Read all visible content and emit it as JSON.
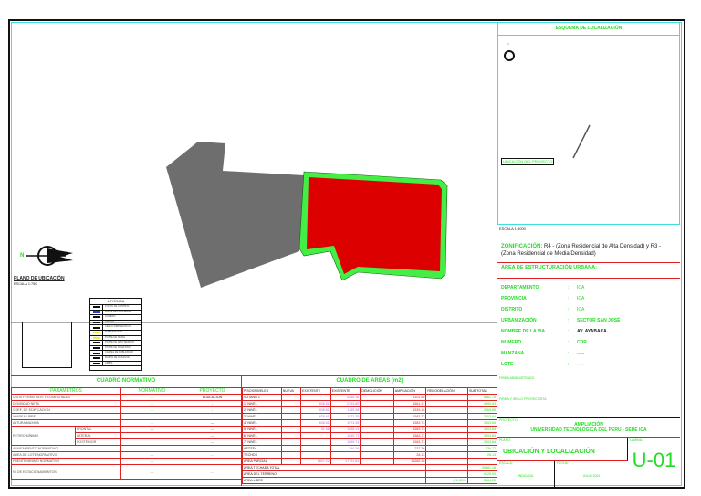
{
  "location_plan": {
    "title": "PLANO DE UBICACIÓN",
    "scale": "ESCALA 1:750",
    "north": "N"
  },
  "legend": {
    "title": "LEYENDA",
    "items": [
      "PUNTO DE CONTROL",
      "LIMITE DE PROPIEDAD",
      "LINDERO",
      "VEREDA",
      "CERCO PERIMETRICO",
      "SUB ESTACION",
      "POSTE DE MEDIA",
      "POSTE DE ALTA TENSION",
      "POSTE DE TELEFONO",
      "CARTEL DE PUBLICIDAD",
      "BUZON DE DESAGUE",
      "ARBOL"
    ]
  },
  "colors": {
    "project": "#dd0000",
    "neighbor": "#6e6e6e",
    "wall": "#44ee44",
    "border": "#3fe0e0",
    "lines": "#e02020",
    "text": "#22dd22"
  },
  "scheme": {
    "title": "ESQUEMA DE LOCALIZACIÓN",
    "north": "N",
    "pointer_label": "UBICACIÓN DEL PROYECTO",
    "scale": "ESCALA 1:5000"
  },
  "info": {
    "zoning_label": "ZONIFICACIÓN:",
    "zoning_value": "R4 - (Zona Residencial de Alta Densidad) y R3 - (Zona Residencial de Media Densidad)",
    "urban_area_label": "AREA DE ESTRUCTURACIÓN URBANA:",
    "urban_area_value": "-",
    "rows": [
      {
        "label": "DEPARTAMENTO",
        "value": "ICA"
      },
      {
        "label": "PROVINCIA",
        "value": "ICA"
      },
      {
        "label": "DISTRITO",
        "value": "ICA"
      },
      {
        "label": "URBANIZACIÓN",
        "value": "SECTOR SAN JOSÉ"
      },
      {
        "label": "NOMBRE DE LA VIA",
        "value": "AV. AYABACA"
      },
      {
        "label": "NUMERO",
        "value": "CDR"
      },
      {
        "label": "MANZANA",
        "value": "-----"
      },
      {
        "label": "LOTE",
        "value": "-----"
      }
    ]
  },
  "title_block": {
    "admin_sign": "FIRMA ADMINISTRADO",
    "designer_sign": "FIRMA Y SELLO PROYECTISTA",
    "project_label": "PROYECTO:",
    "project_line1": "AMPLIACIÓN",
    "project_line2": "UNIVERSIDAD TECNOLOGICA DEL PERU - SEDE ICA",
    "plan_label": "PLANO:",
    "plan_value": "UBICACIÓN Y LOCALIZACIÓN",
    "sheet_label": "LAMINA:",
    "sheet_value": "U-01",
    "scale_label": "ESCALA:",
    "scale_value": "INDICADA",
    "date_label": "FECHA:",
    "date_value": "JULIO 2021"
  },
  "normative": {
    "title": "CUADRO NORMATIVO",
    "headers": [
      "PARAMETROS",
      "NORMATIVO",
      "PROYECTO"
    ],
    "rows": [
      {
        "p": "USOS PERMITIDOS Y COMPATIBLES",
        "n": "---",
        "v": "EDUCACION"
      },
      {
        "p": "DENSIDAD NETA",
        "n": "---",
        "v": "-"
      },
      {
        "p": "COEF. DE EDIFICACION",
        "n": "---",
        "v": "-"
      },
      {
        "p": "% AREA LIBRE",
        "n": "---",
        "v": "---"
      },
      {
        "p": "ALTURA MAXIMA",
        "n": "---",
        "v": "---"
      }
    ],
    "setback_label": "RETIRO MÍNIMO",
    "setbacks": [
      {
        "p": "FRONTAL",
        "n": "---",
        "v": "---"
      },
      {
        "p": "LATERAL",
        "n": "-",
        "v": "---"
      },
      {
        "p": "POSTERIOR",
        "n": "-",
        "v": "---"
      }
    ],
    "rows2": [
      {
        "p": "ALINEAMIENTO NORMATIVO",
        "n": "---",
        "v": ""
      },
      {
        "p": "AREA DE LOTE NORMATIVO",
        "n": "---",
        "v": "---"
      },
      {
        "p": "FRENTE MÍNIMO NORMATIVO",
        "n": "---",
        "v": ""
      },
      {
        "p": "N° DE ESTACIONAMIENTOS",
        "n": "---",
        "v": "---"
      }
    ]
  },
  "areas": {
    "title": "CUADRO DE AREAS (m2)",
    "headers": [
      "PISOS/NIVELES",
      "NUEVA",
      "EXISTENTE",
      "EXISTENTE",
      "DEMOLICIÓN",
      "AMPLIACIÓN",
      "REMODELACIÓN",
      "SUB TOTAL"
    ],
    "rows": [
      [
        "SOTANO 1",
        "",
        "",
        "4266.16",
        "-",
        "5101.50",
        "-",
        "8861.76"
      ],
      [
        "1° NIVEL",
        "",
        "838.61",
        "2194.80",
        "-",
        "1661.37",
        "-",
        "4690.83"
      ],
      [
        "2° NIVEL",
        "",
        "838.61",
        "1185.38",
        "-",
        "1539.10",
        "-",
        "2569.89"
      ],
      [
        "3° NIVEL",
        "",
        "838.61",
        "1073.35",
        "-",
        "1583.73",
        "-",
        "3503.64"
      ],
      [
        "4° NIVEL",
        "",
        "838.61",
        "1073.35",
        "-",
        "1583.73",
        "-",
        "3503.64"
      ],
      [
        "5° NIVEL",
        "",
        "51.58",
        "1858.13",
        "-",
        "1583.73",
        "-",
        "3503.64"
      ],
      [
        "6° NIVEL",
        "",
        "",
        "1859.71",
        "-",
        "1583.73",
        "-",
        "3503.64"
      ],
      [
        "7° NIVEL",
        "",
        "",
        "1859.71",
        "-",
        "1583.73",
        "-",
        "3503.64"
      ],
      [
        "AZOTEA",
        "",
        "",
        "289.36",
        "-",
        "237.36",
        "-",
        "536.77"
      ],
      [
        "TECHOS",
        "",
        "",
        "",
        "-",
        "26.13",
        "-",
        "26.13"
      ]
    ],
    "partial": [
      "AREA PARCIAL",
      "",
      "1807.22",
      "17131.84",
      "",
      "15282.16",
      "",
      ""
    ],
    "totals": [
      {
        "label": "AREA TECHADA TOTAL",
        "value": "35681.18"
      },
      {
        "label": "AREA DEL TERRENO",
        "value": "9725.93"
      },
      {
        "label": "AREA LIBRE",
        "value": "8864.23",
        "extra": "(91.15%)"
      }
    ]
  }
}
